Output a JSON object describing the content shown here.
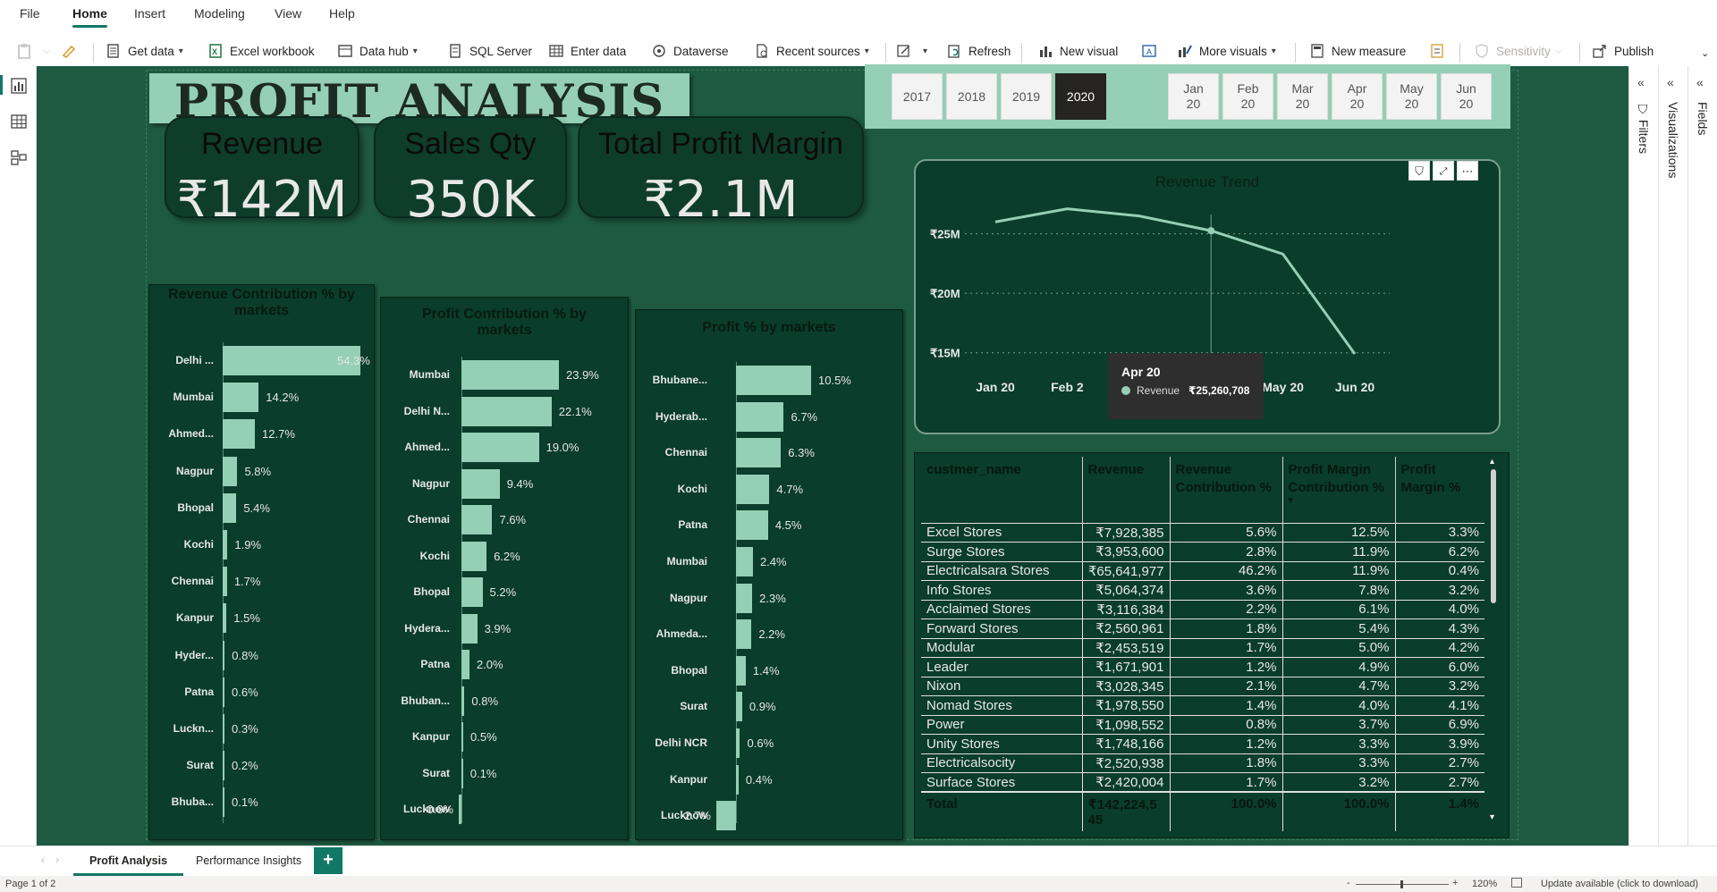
{
  "menu": [
    "File",
    "Home",
    "Insert",
    "Modeling",
    "View",
    "Help"
  ],
  "ribbon": {
    "get_data": "Get data",
    "excel": "Excel workbook",
    "data_hub": "Data hub",
    "sql": "SQL Server",
    "enter_data": "Enter data",
    "dataverse": "Dataverse",
    "recent": "Recent sources",
    "refresh": "Refresh",
    "new_visual": "New visual",
    "more_visuals": "More visuals",
    "new_measure": "New measure",
    "sensitivity": "Sensitivity",
    "publish": "Publish"
  },
  "report": {
    "title": "PROFIT ANALYSIS",
    "kpis": [
      {
        "label": "Revenue",
        "value": "₹142M"
      },
      {
        "label": "Sales Qty",
        "value": "350K"
      },
      {
        "label": "Total Profit Margin",
        "value": "₹2.1M"
      }
    ],
    "years": [
      "2017",
      "2018",
      "2019",
      "2020"
    ],
    "selected_year": "2020",
    "months": [
      [
        "Jan",
        "20"
      ],
      [
        "Feb",
        "20"
      ],
      [
        "Mar",
        "20"
      ],
      [
        "Apr",
        "20"
      ],
      [
        "May",
        "20"
      ],
      [
        "Jun",
        "20"
      ]
    ]
  },
  "chart_data": [
    {
      "type": "bar",
      "orientation": "horizontal",
      "title": "Revenue Contribution % by markets",
      "categories": [
        "Delhi ...",
        "Mumbai",
        "Ahmed...",
        "Nagpur",
        "Bhopal",
        "Kochi",
        "Chennai",
        "Kanpur",
        "Hyder...",
        "Patna",
        "Luckn...",
        "Surat",
        "Bhuba..."
      ],
      "values": [
        54.3,
        14.2,
        12.7,
        5.8,
        5.4,
        1.9,
        1.7,
        1.5,
        0.8,
        0.6,
        0.3,
        0.2,
        0.1
      ],
      "labels": [
        "54.3%",
        "14.2%",
        "12.7%",
        "5.8%",
        "5.4%",
        "1.9%",
        "1.7%",
        "1.5%",
        "0.8%",
        "0.6%",
        "0.3%",
        "0.2%",
        "0.1%"
      ],
      "xlim": [
        0,
        54.3
      ]
    },
    {
      "type": "bar",
      "orientation": "horizontal",
      "title": "Profit Contribution % by markets",
      "categories": [
        "Mumbai",
        "Delhi N...",
        "Ahmed...",
        "Nagpur",
        "Chennai",
        "Kochi",
        "Bhopal",
        "Hydera...",
        "Patna",
        "Bhuban...",
        "Kanpur",
        "Surat",
        "Lucknow"
      ],
      "values": [
        23.9,
        22.1,
        19.0,
        9.4,
        7.6,
        6.2,
        5.2,
        3.9,
        2.0,
        0.8,
        0.5,
        0.1,
        -0.6
      ],
      "labels": [
        "23.9%",
        "22.1%",
        "19.0%",
        "9.4%",
        "7.6%",
        "6.2%",
        "5.2%",
        "3.9%",
        "2.0%",
        "0.8%",
        "0.5%",
        "0.1%",
        "-0.6%"
      ],
      "xlim": [
        -0.6,
        23.9
      ]
    },
    {
      "type": "bar",
      "orientation": "horizontal",
      "title": "Profit % by markets",
      "categories": [
        "Bhubane...",
        "Hyderab...",
        "Chennai",
        "Kochi",
        "Patna",
        "Mumbai",
        "Nagpur",
        "Ahmeda...",
        "Bhopal",
        "Surat",
        "Delhi NCR",
        "Kanpur",
        "Lucknow"
      ],
      "values": [
        10.5,
        6.7,
        6.3,
        4.7,
        4.5,
        2.4,
        2.3,
        2.2,
        1.4,
        0.9,
        0.6,
        0.4,
        -2.7
      ],
      "labels": [
        "10.5%",
        "6.7%",
        "6.3%",
        "4.7%",
        "4.5%",
        "2.4%",
        "2.3%",
        "2.2%",
        "1.4%",
        "0.9%",
        "0.6%",
        "0.4%",
        "-2.7%"
      ],
      "xlim": [
        -2.7,
        10.5
      ]
    },
    {
      "type": "line",
      "title": "Revenue Trend",
      "x": [
        "Jan 20",
        "Feb 20",
        "Mar 20",
        "Apr 20",
        "May 20",
        "Jun 20"
      ],
      "x_tick_labels": [
        "Jan 20",
        "Feb 2",
        "",
        "Apr 20",
        "May 20",
        "Jun 20"
      ],
      "series": [
        {
          "name": "Revenue",
          "values": [
            26000000,
            27100000,
            26500000,
            25260708,
            23300000,
            14900000
          ]
        }
      ],
      "ylim": [
        14000000,
        28500000
      ],
      "y_ticks": [
        {
          "value": 15000000,
          "label": "₹15M"
        },
        {
          "value": 20000000,
          "label": "₹20M"
        },
        {
          "value": 25000000,
          "label": "₹25M"
        }
      ],
      "grid": true,
      "tooltip": {
        "month": "Apr 20",
        "series": "Revenue",
        "value": "₹25,260,708"
      }
    }
  ],
  "table": {
    "headers": [
      "custmer_name",
      "Revenue",
      "Revenue Contribution %",
      "Profit Margin Contribution %",
      "Profit Margin %"
    ],
    "rows": [
      [
        "Excel Stores",
        "₹7,928,385",
        "5.6%",
        "12.5%",
        "3.3%"
      ],
      [
        "Surge Stores",
        "₹3,953,600",
        "2.8%",
        "11.9%",
        "6.2%"
      ],
      [
        "Electricalsara Stores",
        "₹65,641,977",
        "46.2%",
        "11.9%",
        "0.4%"
      ],
      [
        "Info Stores",
        "₹5,064,374",
        "3.6%",
        "7.8%",
        "3.2%"
      ],
      [
        "Acclaimed Stores",
        "₹3,116,384",
        "2.2%",
        "6.1%",
        "4.0%"
      ],
      [
        "Forward Stores",
        "₹2,560,961",
        "1.8%",
        "5.4%",
        "4.3%"
      ],
      [
        "Modular",
        "₹2,453,519",
        "1.7%",
        "5.0%",
        "4.2%"
      ],
      [
        "Leader",
        "₹1,671,901",
        "1.2%",
        "4.9%",
        "6.0%"
      ],
      [
        "Nixon",
        "₹3,028,345",
        "2.1%",
        "4.7%",
        "3.2%"
      ],
      [
        "Nomad Stores",
        "₹1,978,550",
        "1.4%",
        "4.0%",
        "4.1%"
      ],
      [
        "Power",
        "₹1,098,552",
        "0.8%",
        "3.7%",
        "6.9%"
      ],
      [
        "Unity Stores",
        "₹1,748,166",
        "1.2%",
        "3.3%",
        "3.9%"
      ],
      [
        "Electricalsocity",
        "₹2,520,938",
        "1.8%",
        "3.3%",
        "2.7%"
      ],
      [
        "Surface Stores",
        "₹2,420,004",
        "1.7%",
        "3.2%",
        "2.7%"
      ]
    ],
    "total": [
      "Total",
      "₹142,224,5 45",
      "100.0%",
      "100.0%",
      "1.4%"
    ]
  },
  "panes": {
    "filters": "Filters",
    "visualizations": "Visualizations",
    "fields": "Fields"
  },
  "tabs": {
    "page1": "Profit Analysis",
    "page2": "Performance Insights",
    "add": "+"
  },
  "status": {
    "page": "Page 1 of 2",
    "zoom": "120%",
    "update": "Update available (click to download)"
  },
  "colors": {
    "canvas": "#1e5a42",
    "panel": "#0a3d2b",
    "accent": "#94cfb6",
    "brand": "#117865"
  }
}
